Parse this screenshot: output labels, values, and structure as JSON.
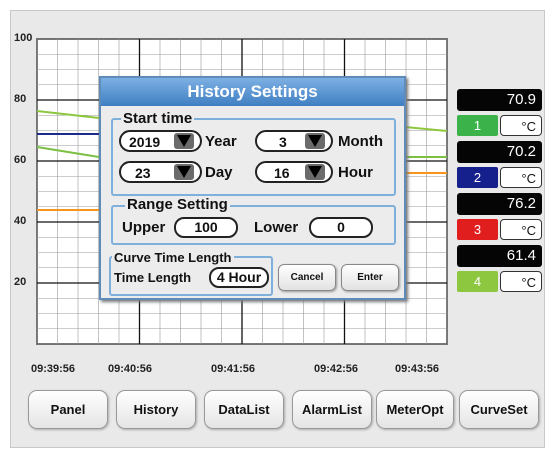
{
  "chart": {
    "y_labels": [
      "100",
      "80",
      "60",
      "40",
      "20"
    ],
    "x_labels": [
      "09:39:56",
      "09:40:56",
      "09:41:56",
      "09:42:56",
      "09:43:56"
    ],
    "line_colors": [
      "#8dc63f",
      "#1a2b8c",
      "#7ac143",
      "#f7941d"
    ]
  },
  "channels": [
    {
      "value": "70.9",
      "number": "1",
      "unit": "°C",
      "color": "#3cb34a"
    },
    {
      "value": "70.2",
      "number": "2",
      "unit": "°C",
      "color": "#16208c"
    },
    {
      "value": "76.2",
      "number": "3",
      "unit": "°C",
      "color": "#e01e1e"
    },
    {
      "value": "61.4",
      "number": "4",
      "unit": "°C",
      "color": "#8dc63f"
    }
  ],
  "nav": {
    "panel": "Panel",
    "history": "History",
    "datalist": "DataList",
    "alarmlist": "AlarmList",
    "meteropt": "MeterOpt",
    "curveset": "CurveSet"
  },
  "dialog": {
    "title": "History Settings",
    "start_time": {
      "title": "Start time",
      "year": {
        "value": "2019",
        "label": "Year"
      },
      "month": {
        "value": "3",
        "label": "Month"
      },
      "day": {
        "value": "23",
        "label": "Day"
      },
      "hour": {
        "value": "16",
        "label": "Hour"
      }
    },
    "range": {
      "title": "Range Setting",
      "upper_label": "Upper",
      "upper_value": "100",
      "lower_label": "Lower",
      "lower_value": "0"
    },
    "curve": {
      "title": "Curve Time Length",
      "label": "Time Length",
      "value": "4 Hour"
    },
    "cancel": "Cancel",
    "enter": "Enter"
  }
}
